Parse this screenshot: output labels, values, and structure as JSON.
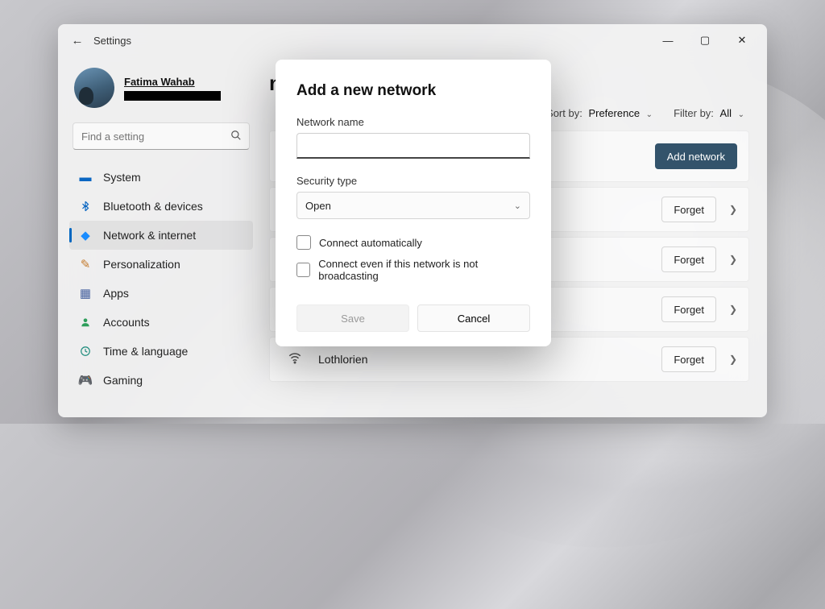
{
  "titlebar": {
    "app_title": "Settings"
  },
  "profile": {
    "username": "Fatima Wahab"
  },
  "search": {
    "placeholder": "Find a setting"
  },
  "nav": {
    "items": [
      {
        "label": "System",
        "icon": "system"
      },
      {
        "label": "Bluetooth & devices",
        "icon": "bluetooth"
      },
      {
        "label": "Network & internet",
        "icon": "network"
      },
      {
        "label": "Personalization",
        "icon": "personalize"
      },
      {
        "label": "Apps",
        "icon": "apps"
      },
      {
        "label": "Accounts",
        "icon": "accounts"
      },
      {
        "label": "Time & language",
        "icon": "time"
      },
      {
        "label": "Gaming",
        "icon": "gaming"
      }
    ],
    "selected_index": 2
  },
  "main": {
    "title_suffix": "networks",
    "sort": {
      "label": "Sort by:",
      "value": "Preference"
    },
    "filter": {
      "label": "Filter by:",
      "value": "All"
    },
    "add_button": "Add network",
    "forget_button": "Forget",
    "networks": [
      {
        "name": "Lothlorien"
      }
    ]
  },
  "modal": {
    "title": "Add a new network",
    "network_name_label": "Network name",
    "network_name_value": "",
    "security_type_label": "Security type",
    "security_type_value": "Open",
    "check_auto": "Connect automatically",
    "check_hidden": "Connect even if this network is not broadcasting",
    "save": "Save",
    "cancel": "Cancel"
  }
}
